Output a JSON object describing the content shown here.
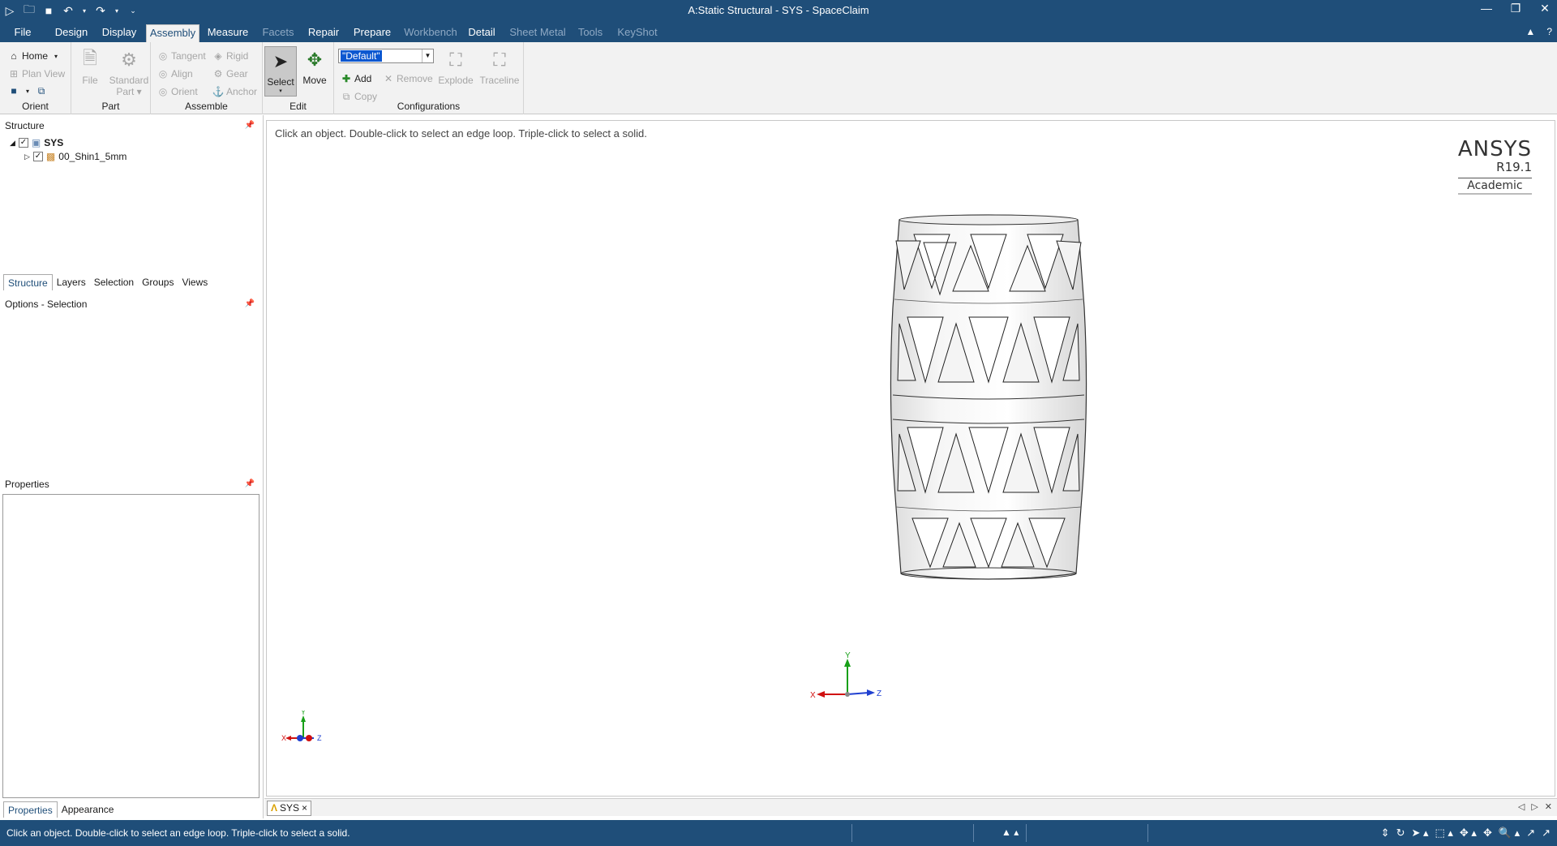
{
  "window": {
    "title": "A:Static Structural - SYS - SpaceClaim",
    "controls": [
      "minimize",
      "restore",
      "close"
    ]
  },
  "menu": {
    "tabs": [
      {
        "label": "File",
        "state": "normal"
      },
      {
        "label": "Design",
        "state": "normal"
      },
      {
        "label": "Display",
        "state": "normal"
      },
      {
        "label": "Assembly",
        "state": "active"
      },
      {
        "label": "Measure",
        "state": "normal"
      },
      {
        "label": "Facets",
        "state": "disabled"
      },
      {
        "label": "Repair",
        "state": "normal"
      },
      {
        "label": "Prepare",
        "state": "normal"
      },
      {
        "label": "Workbench",
        "state": "disabled"
      },
      {
        "label": "Detail",
        "state": "normal"
      },
      {
        "label": "Sheet Metal",
        "state": "disabled"
      },
      {
        "label": "Tools",
        "state": "disabled"
      },
      {
        "label": "KeyShot",
        "state": "disabled"
      }
    ]
  },
  "ribbon": {
    "orient": {
      "label": "Orient",
      "home": "Home",
      "plan_view": "Plan View"
    },
    "part": {
      "label": "Part",
      "file": "File",
      "standard_part_1": "Standard",
      "standard_part_2": "Part ▾"
    },
    "assemble": {
      "label": "Assemble",
      "tangent": "Tangent",
      "rigid": "Rigid",
      "align": "Align",
      "gear": "Gear",
      "orient": "Orient",
      "anchor": "Anchor"
    },
    "edit": {
      "label": "Edit",
      "select": "Select",
      "move": "Move"
    },
    "configurations": {
      "label": "Configurations",
      "selected": "\"Default\"",
      "add": "Add",
      "remove": "Remove",
      "copy": "Copy",
      "explode": "Explode",
      "traceline": "Traceline"
    }
  },
  "structure": {
    "header": "Structure",
    "tree": [
      {
        "label": "SYS",
        "level": 0,
        "checked": true
      },
      {
        "label": "00_Shin1_5mm",
        "level": 1,
        "checked": true
      }
    ],
    "tabs": [
      "Structure",
      "Layers",
      "Selection",
      "Groups",
      "Views"
    ]
  },
  "options": {
    "header": "Options - Selection"
  },
  "properties": {
    "header": "Properties",
    "tabs": [
      "Properties",
      "Appearance"
    ]
  },
  "viewport": {
    "hint": "Click an object. Double-click to select an edge loop. Triple-click to select a solid.",
    "brand": {
      "name": "ANSYS",
      "version": "R19.1",
      "edition": "Academic"
    },
    "axes": {
      "x": "X",
      "y": "Y",
      "z": "Z"
    }
  },
  "document_tab": {
    "label": "SYS",
    "close": "×"
  },
  "status": {
    "text": "Click an object. Double-click to select an edge loop. Triple-click to select a solid."
  },
  "colors": {
    "chrome": "#1f4e79",
    "ribbon": "#f2f2f2",
    "axis_x": "#d01010",
    "axis_y": "#18a018",
    "axis_z": "#2040d0"
  }
}
